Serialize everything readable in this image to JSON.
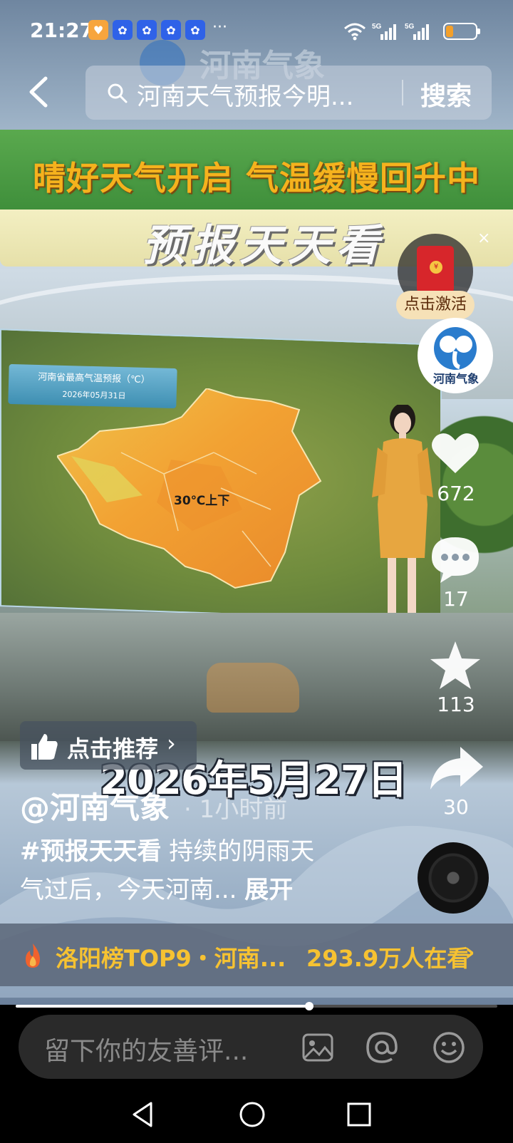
{
  "status_bar": {
    "time": "21:27",
    "more": "···",
    "net_label_1": "5G",
    "net_label_2": "5G"
  },
  "colors": {
    "accent_gold": "#f6c232",
    "banner_green": "#4e9e45",
    "battery_orange": "#f3a02b",
    "redpack_red": "#d7262b"
  },
  "battery": {
    "level": 0.25
  },
  "top_nav": {
    "search_text": "河南天气预报今明...",
    "search_button": "搜索",
    "watermark_text": "河南气象"
  },
  "video": {
    "headline": "晴好天气开启 气温缓慢回升中",
    "program_title": "预报天天看",
    "map_title": "河南省最高气温预报（℃）",
    "map_date": "2026年05月31日",
    "map_label": "30℃上下",
    "date_caption": "2026年5月27日",
    "close_symbol": "×"
  },
  "side": {
    "activate_label": "点击激活",
    "avatar_label": "河南气象",
    "likes": "672",
    "comments": "17",
    "favorites": "113",
    "shares": "30"
  },
  "info": {
    "recommend_label": "点击推荐",
    "recommend_arrow": "›",
    "author": "@河南气象",
    "post_time": "· 1小时前",
    "hashtag": "#预报天天看",
    "desc_part1": " 持续的阴雨天",
    "desc_part2": "气过后，今天河南...",
    "expand": "展开"
  },
  "hot": {
    "title": "洛阳榜TOP9・河南...",
    "count": "293.9万人在看",
    "arrow": "›"
  },
  "playback": {
    "progress": 0.61
  },
  "comment_bar": {
    "placeholder": "留下你的友善评..."
  }
}
